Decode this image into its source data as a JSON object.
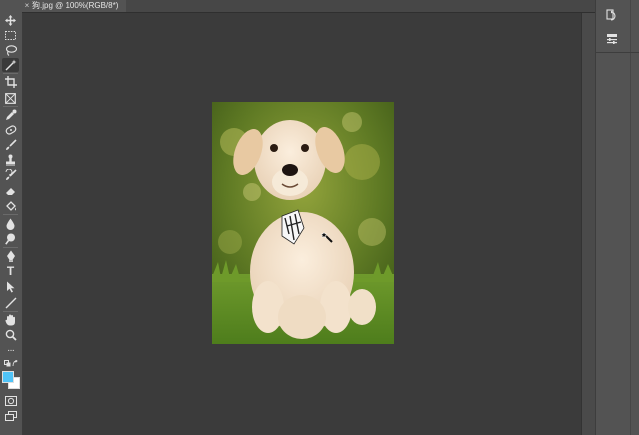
{
  "document": {
    "tab_title": "狗.jpg @ 100%(RGB/8*)",
    "close_symbol": "×"
  },
  "toolbar": {
    "tools": [
      {
        "name": "move-tool-icon"
      },
      {
        "name": "marquee-tool-icon"
      },
      {
        "name": "lasso-tool-icon"
      },
      {
        "name": "magic-wand-tool-icon"
      },
      {
        "name": "crop-tool-icon"
      },
      {
        "name": "frame-tool-icon"
      },
      {
        "name": "eyedropper-tool-icon"
      },
      {
        "name": "healing-brush-tool-icon"
      },
      {
        "name": "brush-tool-icon"
      },
      {
        "name": "clone-stamp-tool-icon"
      },
      {
        "name": "history-brush-tool-icon"
      },
      {
        "name": "eraser-tool-icon"
      },
      {
        "name": "paint-bucket-tool-icon"
      },
      {
        "name": "blur-tool-icon"
      },
      {
        "name": "dodge-tool-icon"
      },
      {
        "name": "pen-tool-icon"
      },
      {
        "name": "type-tool-icon"
      },
      {
        "name": "path-selection-tool-icon"
      },
      {
        "name": "line-tool-icon"
      },
      {
        "name": "hand-tool-icon"
      },
      {
        "name": "zoom-tool-icon"
      },
      {
        "name": "more-tools-icon"
      }
    ],
    "type_glyph": "T",
    "more_glyph": "···",
    "foreground_color": "#4fc3f7",
    "background_color": "#ffffff"
  },
  "right_dock": {
    "buttons": [
      {
        "name": "history-panel-icon"
      },
      {
        "name": "properties-panel-icon"
      }
    ]
  },
  "colors": {
    "app_bg": "#535353",
    "canvas_bg": "#3b3b3b",
    "tab_bg": "#474747"
  }
}
